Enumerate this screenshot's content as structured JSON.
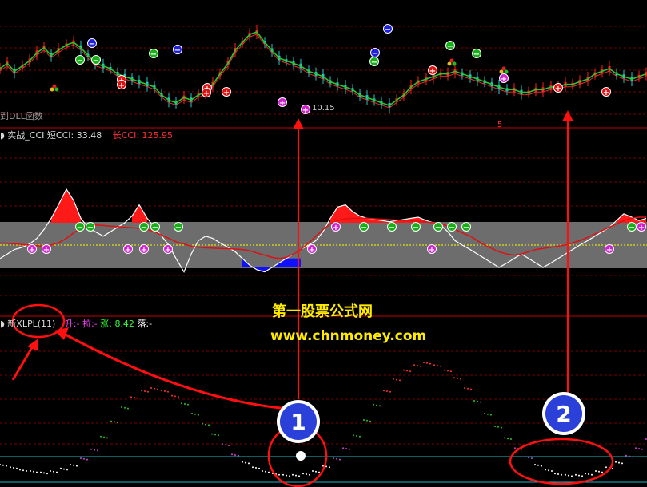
{
  "colors": {
    "background": "#000000",
    "grid": "#7a0000",
    "panel_divider": "#c00000",
    "cyan_line": "#19b9c7",
    "cci_band": "#808080",
    "cci_white": "#ffffff",
    "cci_red": "#e01010",
    "fill_red": "#ff1a1a",
    "fill_green": "#18d018",
    "fill_blue": "#1010ff",
    "fill_magenta": "#ff00ff",
    "annotation_red": "#ff1010",
    "price_up": "#ff2020",
    "price_down": "#20c8c8",
    "ma_green": "#28c828",
    "ma_red": "#e03030"
  },
  "price_panel": {
    "dll_label": "到DLL函数",
    "low_label": "10.15",
    "marker_5": "5"
  },
  "cci_panel": {
    "name": "实战_CCI",
    "short_label": "短CCI:",
    "short_value": "33.48",
    "long_label": "长CCI:",
    "long_value": "125.95"
  },
  "xlpl_panel": {
    "name": "新XLPL(11)",
    "rise_label": "升:",
    "rise_value": "-",
    "pull_label": "拉:",
    "pull_value": "-",
    "up_label": "涨:",
    "up_value": "8.42",
    "fall_label": "落:",
    "fall_value": "-"
  },
  "watermark": {
    "line1": "第一股票公式网",
    "line2": "www.chnmoney.com"
  },
  "annotations": {
    "badge_1": "1",
    "badge_2": "2"
  },
  "chart_data": [
    {
      "type": "line",
      "panel": "price",
      "series": [
        {
          "values": [
            48,
            50,
            47,
            49,
            51,
            54,
            56,
            53,
            55,
            57,
            58,
            56,
            53,
            50,
            49,
            48,
            46,
            45,
            44,
            43,
            42,
            41,
            38,
            36,
            35,
            37,
            36,
            38,
            39,
            42,
            46,
            50,
            55,
            58,
            61,
            62,
            58,
            55,
            52,
            51,
            50,
            49,
            47,
            46,
            45,
            43,
            42,
            41,
            40,
            38,
            37,
            36,
            35,
            34,
            36,
            38,
            41,
            43,
            44,
            45,
            46,
            46,
            47,
            46,
            45,
            44,
            43,
            42,
            41,
            40,
            40,
            39,
            39,
            40,
            40,
            41,
            41,
            42,
            42,
            43,
            44,
            46,
            47,
            48,
            46,
            45,
            44,
            45,
            46
          ]
        }
      ]
    },
    {
      "type": "line",
      "panel": "cci",
      "series": [
        {
          "values": [
            -60,
            -40,
            -20,
            -10,
            5,
            30,
            70,
            120,
            180,
            250,
            200,
            120,
            80,
            60,
            40,
            60,
            80,
            100,
            130,
            180,
            120,
            80,
            40,
            0,
            -60,
            -120,
            -40,
            20,
            40,
            30,
            10,
            -10,
            -30,
            -60,
            -90,
            -110,
            -120,
            -100,
            -80,
            -60,
            -40,
            -20,
            0,
            20,
            60,
            120,
            170,
            180,
            150,
            130,
            120,
            115,
            110,
            105,
            110,
            115,
            120,
            125,
            110,
            100,
            90,
            60,
            20,
            0,
            -20,
            -40,
            -60,
            -80,
            -100,
            -80,
            -60,
            -40,
            -60,
            -80,
            -100,
            -80,
            -60,
            -40,
            -20,
            0,
            20,
            40,
            60,
            80,
            110,
            140,
            125,
            110,
            120
          ]
        },
        {
          "values": [
            10,
            8,
            5,
            3,
            0,
            -3,
            -5,
            0,
            10,
            30,
            55,
            75,
            85,
            90,
            88,
            85,
            83,
            80,
            78,
            75,
            70,
            60,
            45,
            30,
            15,
            5,
            -5,
            -10,
            -12,
            -14,
            -15,
            -16,
            -18,
            -20,
            -25,
            -35,
            -45,
            -55,
            -60,
            -55,
            -40,
            -20,
            10,
            40,
            70,
            95,
            110,
            118,
            120,
            120,
            120,
            118,
            116,
            114,
            112,
            110,
            108,
            106,
            104,
            100,
            95,
            85,
            70,
            55,
            40,
            20,
            0,
            -15,
            -30,
            -40,
            -45,
            -40,
            -30,
            -20,
            -15,
            -10,
            -5,
            0,
            10,
            20,
            35,
            50,
            65,
            80,
            95,
            110,
            120,
            125,
            125
          ]
        }
      ]
    },
    {
      "type": "scatter",
      "panel": "xlpl",
      "series": [
        {
          "values": [
            10,
            8,
            6,
            5,
            4,
            5,
            7,
            10,
            15,
            22,
            32,
            44,
            55,
            63,
            68,
            70,
            68,
            64,
            58,
            50,
            42,
            34,
            26,
            18,
            12,
            8,
            5,
            3,
            2,
            2,
            3,
            5,
            9,
            15,
            23,
            33,
            45,
            57,
            68,
            77,
            84,
            88,
            90,
            88,
            84,
            78,
            70,
            60,
            50,
            40,
            31,
            23,
            16,
            10,
            6,
            3,
            2,
            2,
            3,
            5,
            8,
            12,
            17,
            23,
            30
          ]
        }
      ]
    }
  ]
}
